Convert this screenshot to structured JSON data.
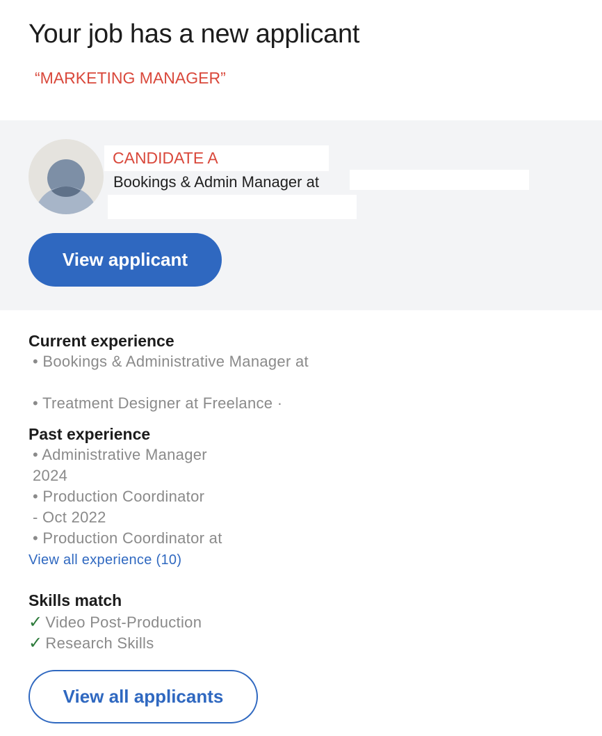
{
  "header": {
    "title": "Your job has a new applicant",
    "job_title": "“MARKETING MANAGER”"
  },
  "applicant": {
    "name": "CANDIDATE A",
    "headline": "Bookings & Admin Manager at",
    "view_button_label": "View applicant",
    "avatar_icon": "person-placeholder-icon"
  },
  "current_experience": {
    "heading": "Current experience",
    "items": [
      "• Bookings & Administrative Manager at",
      "• Treatment Designer at Freelance ·"
    ]
  },
  "past_experience": {
    "heading": "Past experience",
    "lines": [
      "• Administrative Manager",
      "2024",
      "• Production Coordinator",
      "- Oct 2022",
      "• Production Coordinator at"
    ],
    "view_all_link": "View all experience (10)"
  },
  "skills_match": {
    "heading": "Skills match",
    "check_glyph": "✓",
    "items": [
      "Video Post-Production",
      "Research Skills"
    ]
  },
  "footer": {
    "view_all_button_label": "View all applicants"
  },
  "colors": {
    "accent_blue": "#2f68c0",
    "highlight_red": "#d9483b",
    "check_green": "#2c7a3a",
    "card_background": "#f3f4f6",
    "secondary_text": "#8a8a8a"
  }
}
